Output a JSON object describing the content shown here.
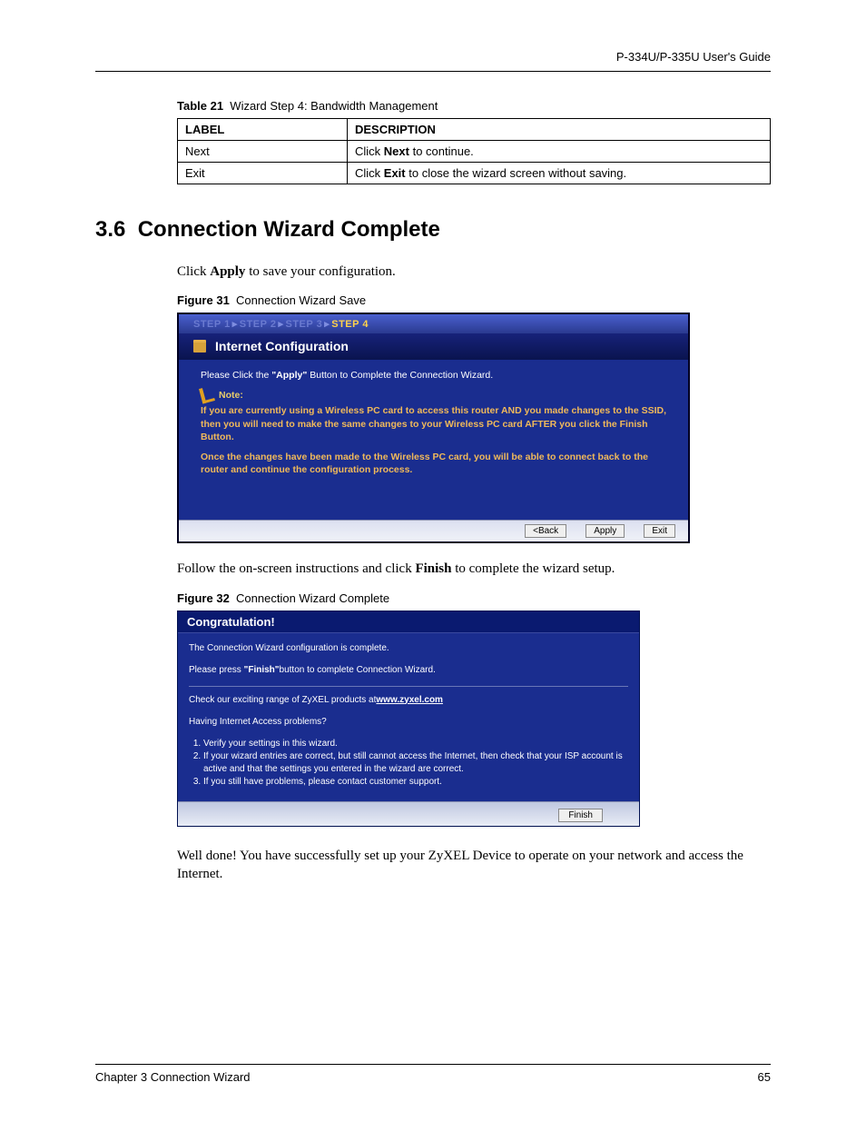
{
  "header": {
    "running": "P-334U/P-335U User's Guide"
  },
  "table21": {
    "caption_bold": "Table 21",
    "caption_rest": "Wizard Step 4: Bandwidth Management",
    "columns": {
      "label": "LABEL",
      "desc": "DESCRIPTION"
    },
    "rows": [
      {
        "label": "Next",
        "pre": "Click ",
        "bold": "Next",
        "post": " to continue."
      },
      {
        "label": "Exit",
        "pre": "Click ",
        "bold": "Exit",
        "post": " to close the wizard screen without saving."
      }
    ]
  },
  "section": {
    "number": "3.6",
    "title": "Connection Wizard Complete",
    "p1_pre": "Click ",
    "p1_bold": "Apply",
    "p1_post": " to save your configuration."
  },
  "figure31": {
    "caption_bold": "Figure 31",
    "caption_rest": "Connection Wizard Save",
    "steps": {
      "s1": "STEP 1",
      "s2": "STEP 2",
      "s3": "STEP 3",
      "s4": "STEP 4"
    },
    "title": "Internet Configuration",
    "line1_pre": "Please Click the ",
    "line1_bold": "\"Apply\"",
    "line1_post": " Button to Complete the Connection Wizard.",
    "note_label": "Note:",
    "note_p1": "If you are currently using a Wireless PC card to access this router AND you made changes to the SSID, then you will need to make the same changes to your Wireless PC card AFTER you click the Finish Button.",
    "note_p2": "Once the changes have been made to the Wireless PC card, you will be able to connect back to the router and continue the configuration process.",
    "buttons": {
      "back": "<Back",
      "apply": "Apply",
      "exit": "Exit"
    }
  },
  "mid": {
    "p_pre": "Follow the on-screen instructions and click ",
    "p_bold": "Finish",
    "p_post": " to complete the wizard setup."
  },
  "figure32": {
    "caption_bold": "Figure 32",
    "caption_rest": "Connection Wizard Complete",
    "title": "Congratulation!",
    "l1": "The Connection Wizard configuration is complete.",
    "l2_pre": "Please press ",
    "l2_bold": "\"Finish\"",
    "l2_post": "button to complete Connection Wizard.",
    "l3_pre": "Check our exciting range of ZyXEL products at",
    "l3_link": "www.zyxel.com",
    "l4": "Having Internet Access problems?",
    "ol": [
      "Verify your settings in this wizard.",
      "If your wizard entries are correct, but still cannot access the Internet, then check that your ISP account is active and that the settings you entered in the wizard are correct.",
      "If you still have problems, please contact customer support."
    ],
    "buttons": {
      "finish": "Finish"
    }
  },
  "closing": "Well done! You have successfully set up your ZyXEL Device to operate on your network and access the Internet.",
  "footer": {
    "left": "Chapter 3 Connection Wizard",
    "right": "65"
  }
}
